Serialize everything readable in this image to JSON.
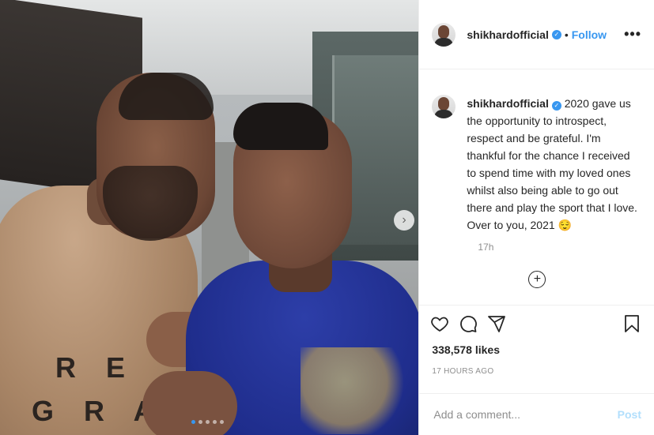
{
  "post": {
    "username": "shikhardofficial",
    "follow_label": "Follow",
    "separator": "•",
    "more_label": "•••",
    "caption": "2020 gave us the opportunity to introspect, respect and be grateful. I'm thankful for the chance I received to spend time with my loved ones whilst also being able to go out there and play the sport that I love. Over to you, 2021 😌",
    "relative_time": "17h",
    "likes": "338,578 likes",
    "timestamp": "17 HOURS AGO",
    "comment_placeholder": "Add a comment...",
    "post_button": "Post",
    "shirt_text_line1": "R E",
    "shirt_text_line2": "G R A",
    "carousel": {
      "slides": 5,
      "active_index": 0
    }
  },
  "icons": {
    "verified": "verified-badge-icon",
    "like": "heart-icon",
    "comment": "comment-icon",
    "share": "paper-plane-icon",
    "save": "bookmark-icon",
    "load_more": "plus-circle-icon",
    "next": "chevron-right-icon"
  },
  "colors": {
    "accent": "#3897f0",
    "post_disabled": "#b2dffc",
    "muted": "#8e8e8e"
  }
}
